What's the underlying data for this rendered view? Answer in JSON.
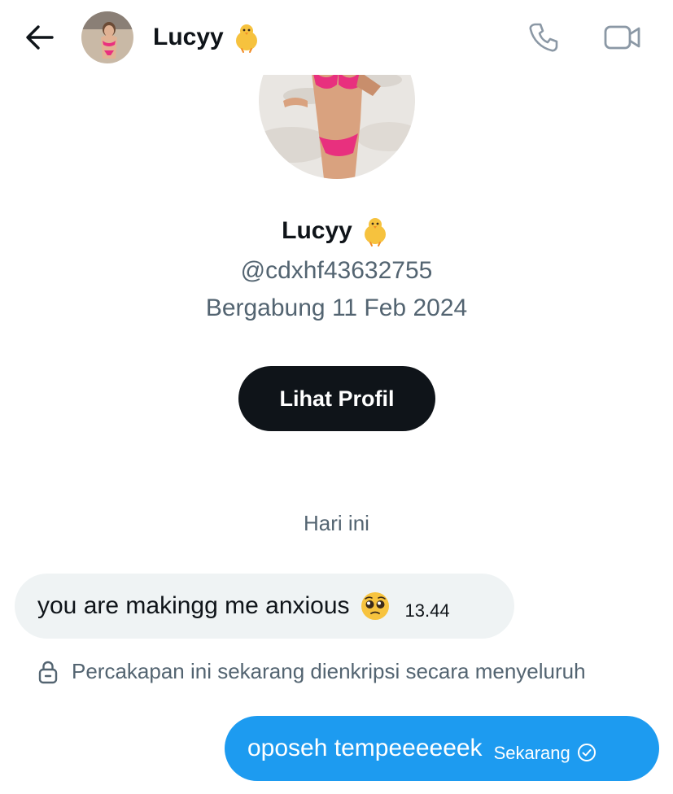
{
  "header": {
    "name": "Lucyy",
    "name_emoji": "hatching-chick",
    "icons": {
      "back": "back-arrow-icon",
      "call": "phone-icon",
      "video": "video-camera-icon"
    }
  },
  "profile": {
    "name": "Lucyy",
    "handle": "@cdxhf43632755",
    "joined": "Bergabung 11 Feb 2024",
    "view_profile_label": "Lihat Profil"
  },
  "conversation": {
    "day_label": "Hari ini",
    "messages": [
      {
        "direction": "incoming",
        "text": "you are makingg me anxious",
        "emoji": "pleading-face",
        "time": "13.44"
      },
      {
        "direction": "outgoing",
        "text": "oposeh tempeeeeeek",
        "time": "Sekarang",
        "status": "sent"
      }
    ],
    "encryption_notice": "Percakapan ini sekarang dienkripsi secara menyeluruh"
  },
  "colors": {
    "accent": "#1d9bf0",
    "text_primary": "#0f1419",
    "text_secondary": "#536471",
    "bubble_incoming": "#eff3f4",
    "button_dark": "#0f1419"
  }
}
